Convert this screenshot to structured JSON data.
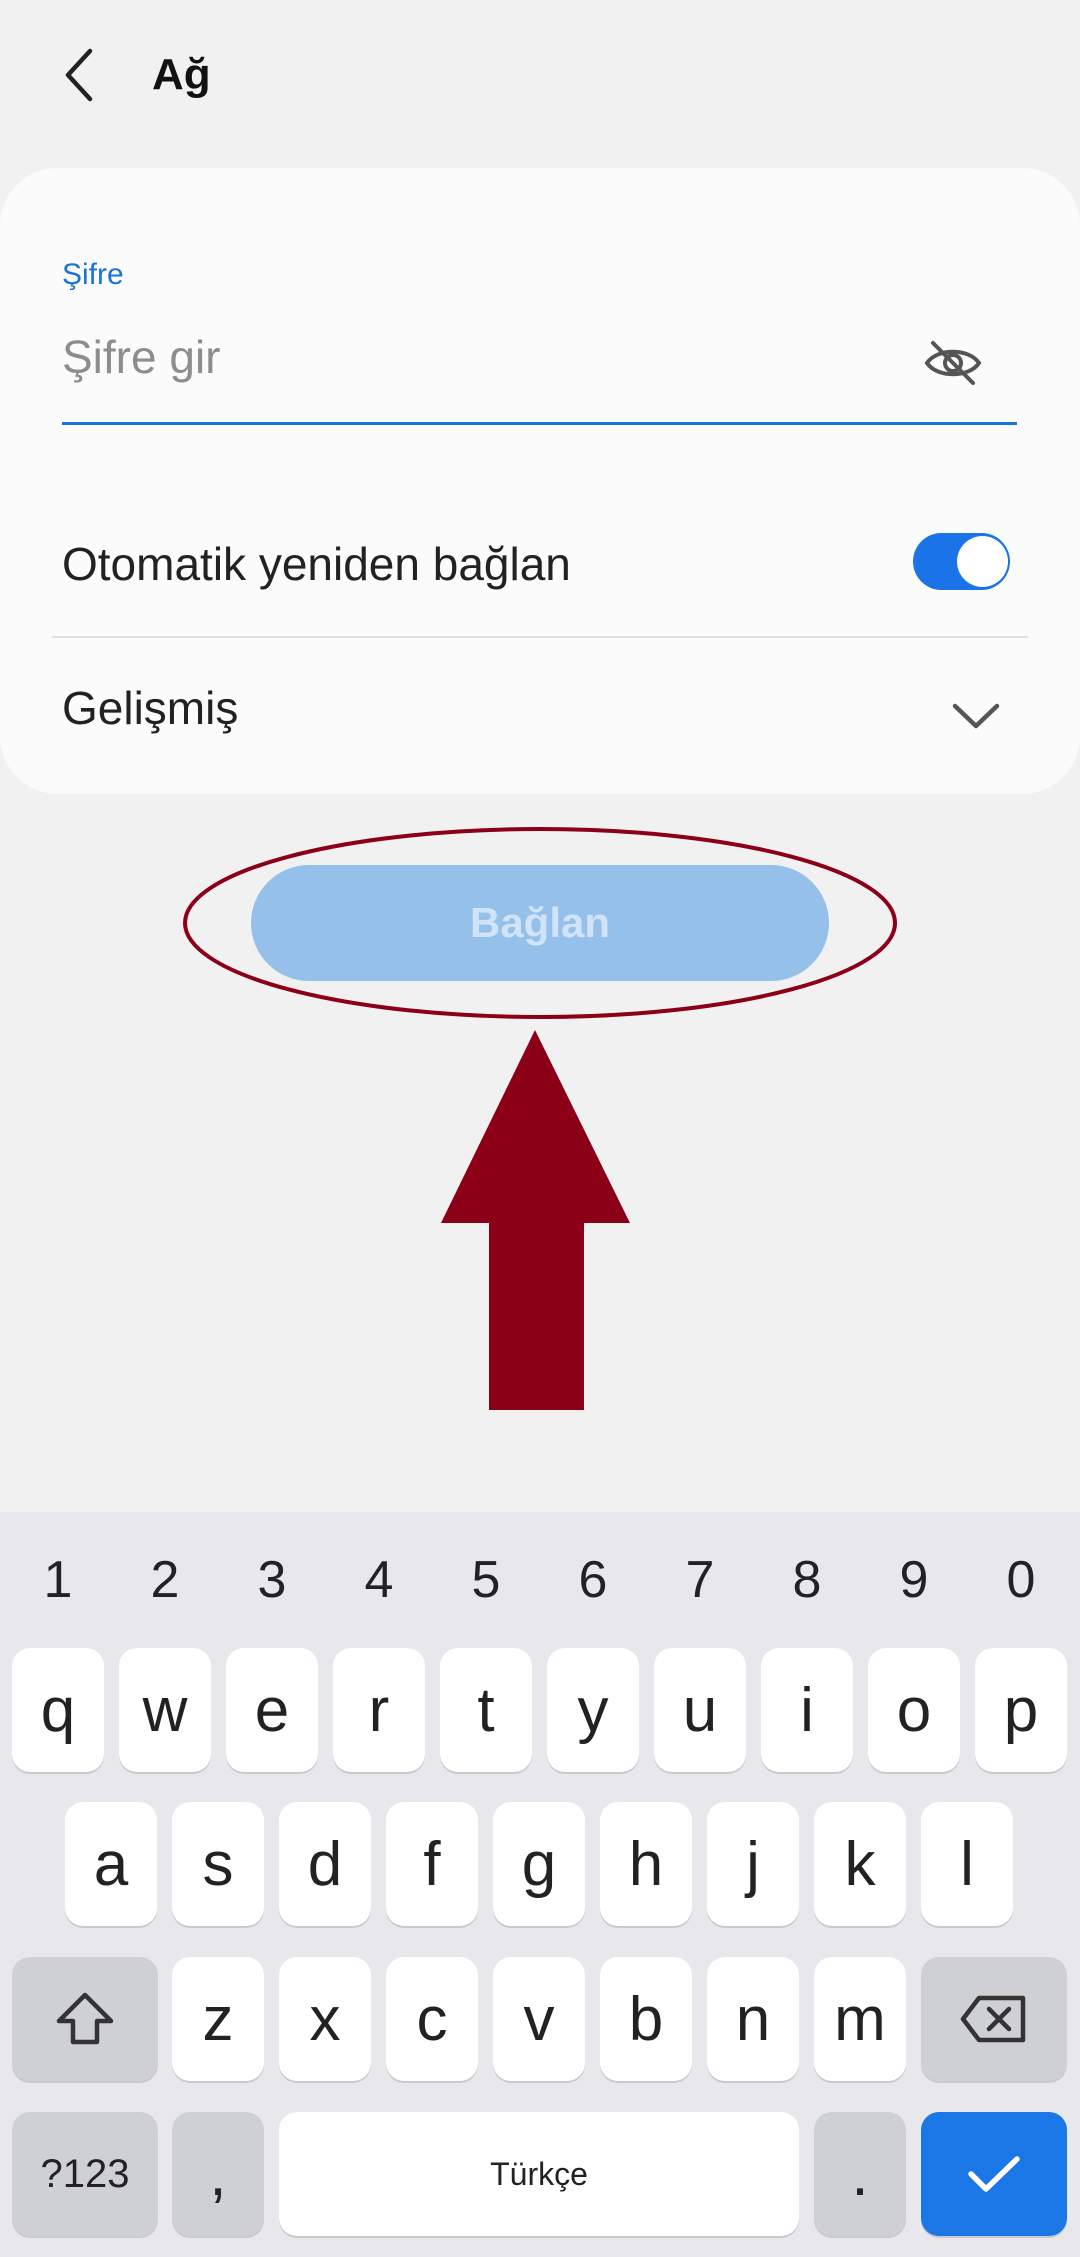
{
  "header": {
    "title": "Ağ",
    "back_icon": "chevron-left-icon"
  },
  "password": {
    "label": "Şifre",
    "placeholder": "Şifre gir",
    "value": "",
    "visibility_icon": "eye-off-icon"
  },
  "auto_reconnect": {
    "label": "Otomatik yeniden bağlan",
    "enabled": true
  },
  "advanced": {
    "label": "Gelişmiş",
    "icon": "chevron-down-icon"
  },
  "connect_button": {
    "label": "Bağlan",
    "enabled": false
  },
  "keyboard": {
    "numbers": [
      "1",
      "2",
      "3",
      "4",
      "5",
      "6",
      "7",
      "8",
      "9",
      "0"
    ],
    "row1": [
      "q",
      "w",
      "e",
      "r",
      "t",
      "y",
      "u",
      "i",
      "o",
      "p"
    ],
    "row2": [
      "a",
      "s",
      "d",
      "f",
      "g",
      "h",
      "j",
      "k",
      "l"
    ],
    "row3": [
      "z",
      "x",
      "c",
      "v",
      "b",
      "n",
      "m"
    ],
    "symbols_label": "?123",
    "comma_label": ",",
    "space_label": "Türkçe",
    "period_label": ".",
    "shift_icon": "shift-icon",
    "backspace_icon": "backspace-icon",
    "enter_icon": "checkmark-icon"
  },
  "colors": {
    "accent": "#1a73d9",
    "toggle_on": "#1b73e8",
    "button_disabled": "#94c0ea",
    "annotation": "#8b0016"
  }
}
